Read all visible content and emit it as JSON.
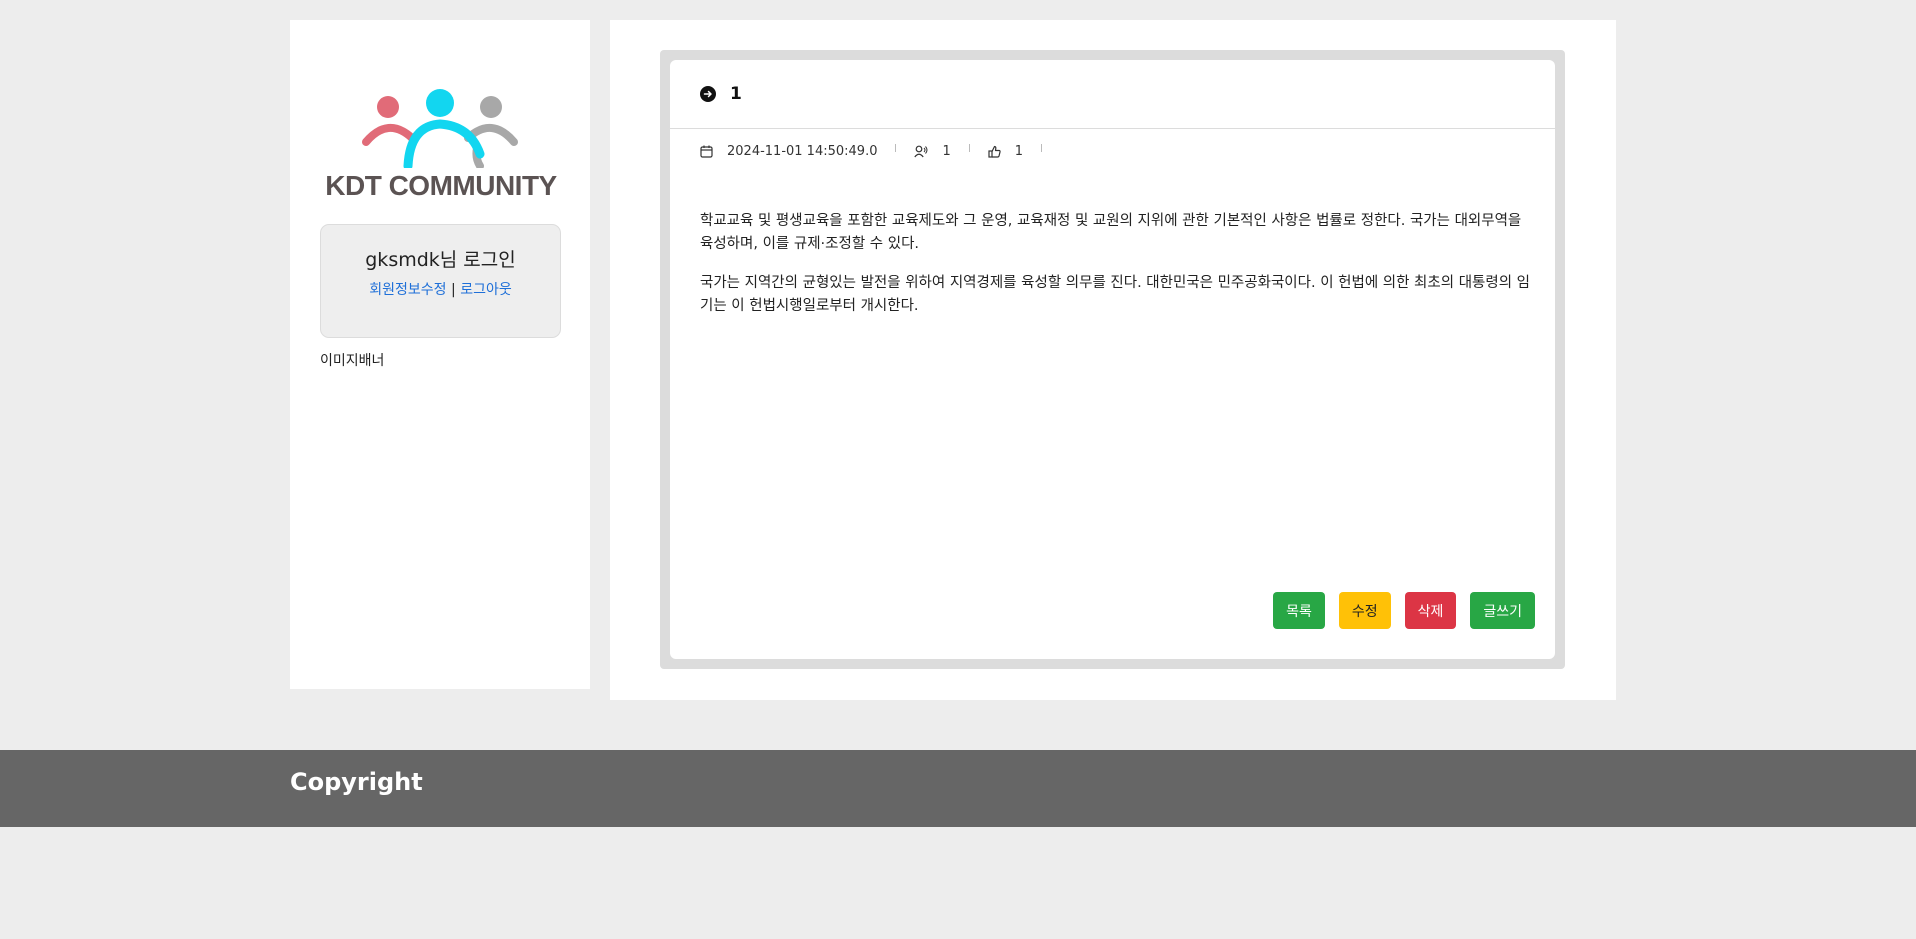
{
  "logo": {
    "text": "KDT COMMUNITY",
    "colors": {
      "left_person": "#e16b78",
      "center_person": "#12d6f0",
      "right_person": "#a8a8a8",
      "text": "#5b5353"
    }
  },
  "login": {
    "title": "gksmdk님 로그인",
    "edit_profile_link": "회원정보수정",
    "separator": "|",
    "logout_link": "로그아웃"
  },
  "sidebar": {
    "image_banner": "이미지배너"
  },
  "post": {
    "title": "1",
    "date": "2024-11-01 14:50:49.0",
    "views": "1",
    "likes": "1",
    "body": [
      "학교교육 및 평생교육을 포함한 교육제도와 그 운영, 교육재정 및 교원의 지위에 관한 기본적인 사항은 법률로 정한다. 국가는 대외무역을 육성하며, 이를 규제·조정할 수 있다.",
      "국가는 지역간의 균형있는 발전을 위하여 지역경제를 육성할 의무를 진다. 대한민국은 민주공화국이다. 이 헌법에 의한 최초의 대통령의 임기는 이 헌법시행일로부터 개시한다."
    ]
  },
  "buttons": {
    "list": "목록",
    "edit": "수정",
    "delete": "삭제",
    "write": "글쓰기"
  },
  "footer": {
    "copyright": "Copyright"
  },
  "colors": {
    "page_bg": "#ededed",
    "footer_bg": "#666666",
    "link": "#1e6fd8",
    "btn_green": "#28a745",
    "btn_yellow": "#ffc107",
    "btn_red": "#dc3545"
  }
}
